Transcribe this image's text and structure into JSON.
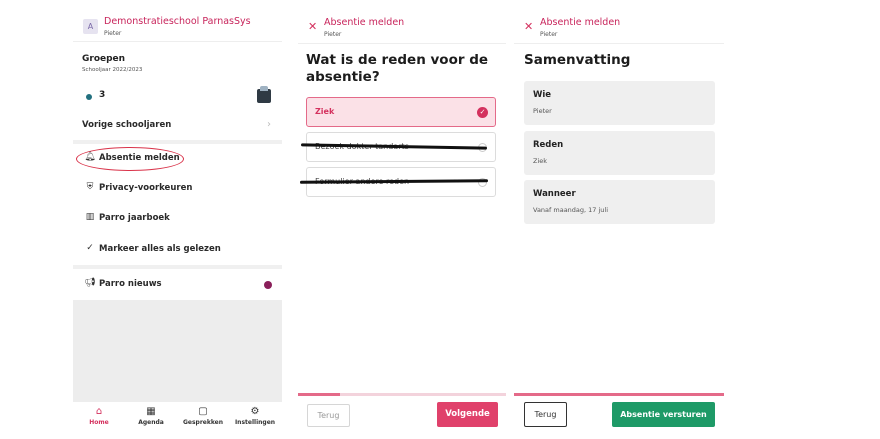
{
  "panel1": {
    "school_name": "Demonstratieschool ParnasSys",
    "user": "Pieter",
    "groups_title": "Groepen",
    "school_year": "Schooljaar 2022/2023",
    "group_count": "3",
    "menu": [
      {
        "label": "Vorige schooljaren",
        "icon": "chevron-right-icon"
      },
      {
        "label": "Absentie melden",
        "icon": "bell-icon"
      },
      {
        "label": "Privacy-voorkeuren",
        "icon": "shield-icon"
      },
      {
        "label": "Parro jaarboek",
        "icon": "book-icon"
      },
      {
        "label": "Markeer alles als gelezen",
        "icon": "double-check-icon"
      },
      {
        "label": "Parro nieuws",
        "icon": "megaphone-icon"
      }
    ],
    "nav": [
      {
        "label": "Home",
        "icon": "home-icon",
        "active": true
      },
      {
        "label": "Agenda",
        "icon": "calendar-icon",
        "active": false
      },
      {
        "label": "Gesprekken",
        "icon": "chat-icon",
        "active": false
      },
      {
        "label": "Instellingen",
        "icon": "gear-icon",
        "active": false
      }
    ],
    "colors": {
      "brand": "#c8245b",
      "highlight_ellipse": "#d9334a",
      "news_dot": "#8a1f5a"
    }
  },
  "panel2": {
    "header_title": "Absentie melden",
    "header_sub": "Pieter",
    "question": "Wat is de reden voor de absentie?",
    "options": [
      {
        "label": "Ziek",
        "selected": true
      },
      {
        "label": "Bezoek dokter tandarts",
        "selected": false
      },
      {
        "label": "Formulier andere reden",
        "selected": false
      }
    ],
    "progress": 0.2,
    "back_label": "Terug",
    "next_label": "Volgende"
  },
  "panel3": {
    "header_title": "Absentie melden",
    "header_sub": "Pieter",
    "title": "Samenvatting",
    "cards": [
      {
        "label": "Wie",
        "value": "Pieter"
      },
      {
        "label": "Reden",
        "value": "Ziek"
      },
      {
        "label": "Wanneer",
        "value": "Vanaf maandag, 17 juli"
      }
    ],
    "back_label": "Terug",
    "send_label": "Absentie versturen",
    "colors": {
      "send_button": "#1e9a67"
    }
  }
}
